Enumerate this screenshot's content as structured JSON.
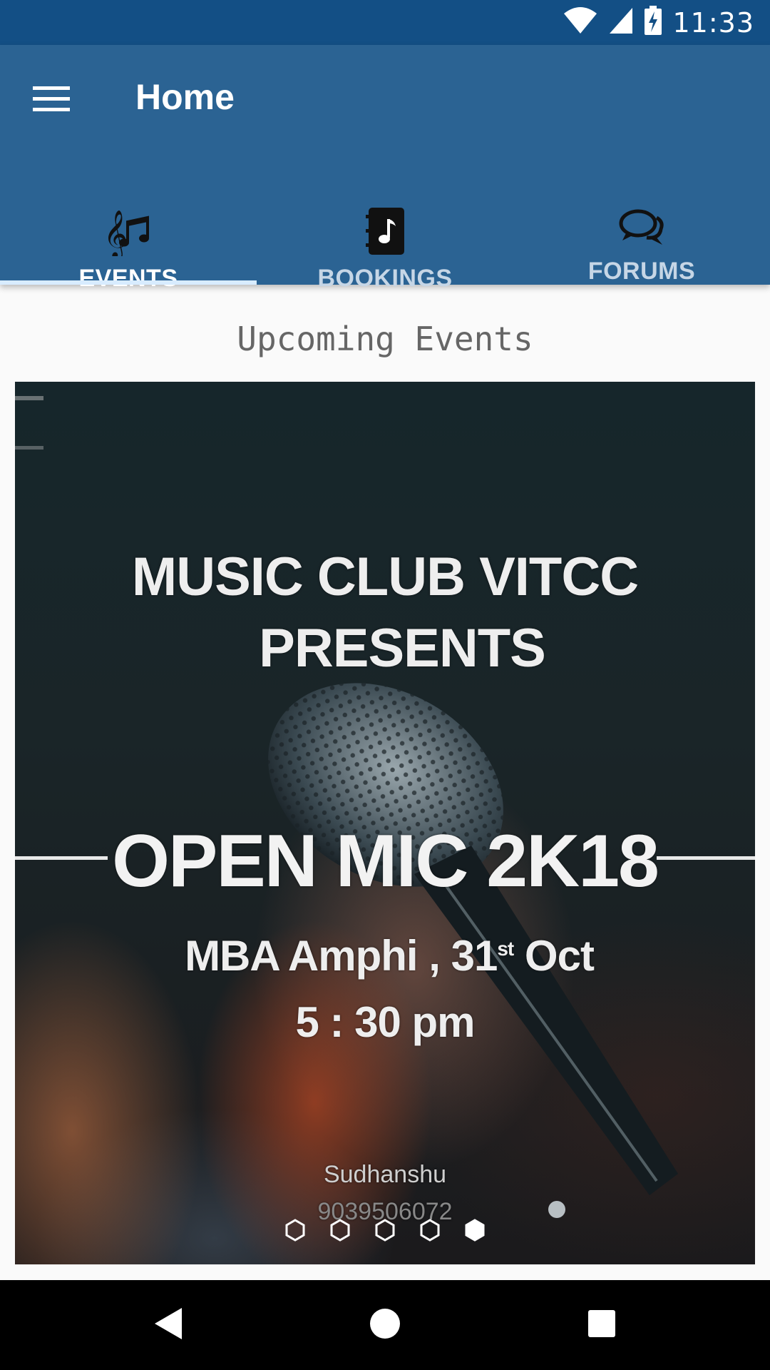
{
  "status_bar": {
    "time": "11:33",
    "icons": [
      "wifi-icon",
      "cell-signal-icon",
      "battery-charging-icon"
    ]
  },
  "app_bar": {
    "title": "Home",
    "menu_icon": "hamburger-menu-icon"
  },
  "tabs": [
    {
      "label": "EVENTS",
      "icon": "music-notes-icon",
      "selected": true
    },
    {
      "label": "BOOKINGS",
      "icon": "music-book-icon",
      "selected": false
    },
    {
      "label": "FORUMS",
      "icon": "chat-bubbles-icon",
      "selected": false
    }
  ],
  "main": {
    "section_title": "Upcoming Events",
    "banner": {
      "line1": "MUSIC CLUB VITCC",
      "line2": "PRESENTS",
      "title": "OPEN MIC 2K18",
      "venue_prefix": "MBA Amphi , 31",
      "venue_sup": "st",
      "venue_suffix": " Oct",
      "time": "5 : 30 pm",
      "contact_name": "Sudhanshu",
      "contact_phone": "9039506072"
    },
    "carousel": {
      "count": 5,
      "active_index": 4
    }
  },
  "nav_bar": {
    "buttons": [
      "back-icon",
      "home-icon",
      "recents-icon"
    ]
  },
  "colors": {
    "status_bar": "#134f85",
    "app_bar": "#2b6393",
    "tab_indicator": "#d8ecff",
    "background": "#fafafa"
  }
}
